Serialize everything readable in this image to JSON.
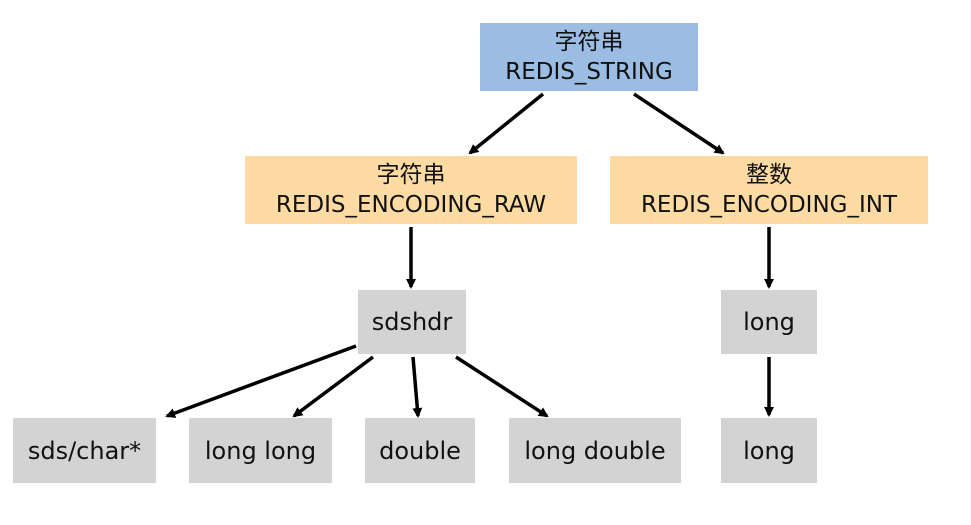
{
  "nodes": {
    "root": {
      "line1": "字符串",
      "line2": "REDIS_STRING"
    },
    "raw": {
      "line1": "字符串",
      "line2": "REDIS_ENCODING_RAW"
    },
    "int": {
      "line1": "整数",
      "line2": "REDIS_ENCODING_INT"
    },
    "sdshdr": {
      "label": "sdshdr"
    },
    "long_mid": {
      "label": "long"
    },
    "sds_char": {
      "label": "sds/char*"
    },
    "long_long": {
      "label": "long long"
    },
    "double": {
      "label": "double"
    },
    "long_double": {
      "label": "long double"
    },
    "long_bottom": {
      "label": "long"
    }
  },
  "colors": {
    "root": "#9bbde3",
    "encoding": "#fddba3",
    "type": "#d3d3d3",
    "arrow": "#000000"
  }
}
